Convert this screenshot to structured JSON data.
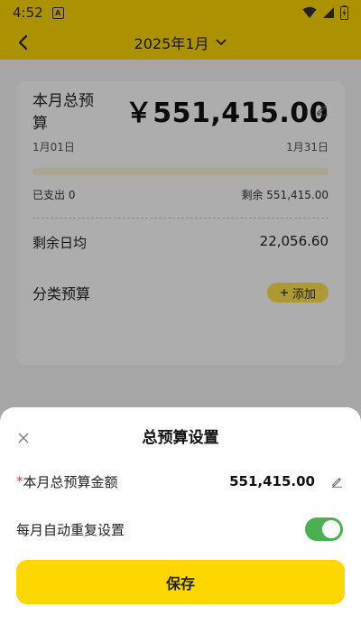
{
  "status_bar": {
    "time": "4:52",
    "app_icon_letter": "A"
  },
  "nav": {
    "month_label": "2025年1月"
  },
  "budget_card": {
    "total_label": "本月总预算",
    "total_amount": "￥551,415.00",
    "start_date": "1月01日",
    "end_date": "1月31日",
    "spent": "已支出 0",
    "remaining": "剩余 551,415.00",
    "daily_label": "剩余日均",
    "daily_value": "22,056.60",
    "category_label": "分类预算",
    "add_label": "添加",
    "spent_progress": 0
  },
  "sheet": {
    "title": "总预算设置",
    "required_mark": "*",
    "amount_label": "本月总预算金额",
    "amount_value": "551,415.00",
    "repeat_label": "每月自动重复设置",
    "repeat_enabled": true,
    "save_label": "保存"
  },
  "colors": {
    "accent": "#FFD700",
    "toggle_on": "#4CAF50",
    "required": "#e53935"
  }
}
